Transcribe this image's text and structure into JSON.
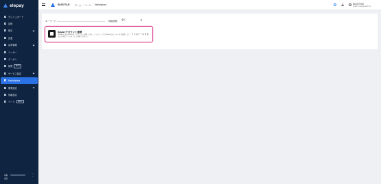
{
  "sidebar": {
    "brand": "elepay",
    "items": [
      {
        "label": "ダッシュボード",
        "icon": "dashboard-icon"
      },
      {
        "label": "記帳",
        "icon": "ledger-icon"
      },
      {
        "label": "取引",
        "icon": "transaction-icon",
        "chevron": true
      },
      {
        "label": "送金",
        "icon": "transfer-icon"
      },
      {
        "label": "請求管理",
        "icon": "billing-icon",
        "chevron": true
      },
      {
        "label": "ユーザー",
        "icon": "user-icon"
      },
      {
        "label": "クーポン",
        "icon": "coupon-icon"
      },
      {
        "label": "帳票",
        "icon": "report-icon",
        "badge": "BETA"
      },
      {
        "label": "サービス設定",
        "icon": "service-settings-icon",
        "chevron": true
      },
      {
        "label": "Marketplace",
        "icon": "marketplace-icon",
        "active": true
      },
      {
        "label": "開発設定",
        "icon": "developer-settings-icon",
        "chevron": true
      },
      {
        "label": "情報設定",
        "icon": "info-settings-icon"
      },
      {
        "label": "ツール",
        "icon": "tool-icon",
        "badge": "BETA"
      }
    ],
    "footer": {
      "line1": "本番",
      "line2": "環境"
    }
  },
  "header": {
    "org_name": "ELESTYLE",
    "breadcrumb": [
      "ホーム",
      "ツール",
      "Marketplace"
    ],
    "user_name": "ELESTYLE",
    "user_email": "ELESTYLE@ELEPAY.IO"
  },
  "filters": {
    "keyword_label": "キーワード",
    "keyword_placeholder": "",
    "status_label": "利用状態",
    "status_value": "全て"
  },
  "apps": [
    {
      "title": "Squareアカウント連携",
      "description": "Squareの決済をelepayアカウントに連携します。ワンストップでSquareの売上データを管理、決済の状況をリアルタイムで把握できます。",
      "install_label": "インストールする",
      "icon": "square-logo-icon"
    }
  ],
  "colors": {
    "sidebar_bg": "#0f2440",
    "active": "#2a72e5",
    "highlight": "#d63384"
  }
}
